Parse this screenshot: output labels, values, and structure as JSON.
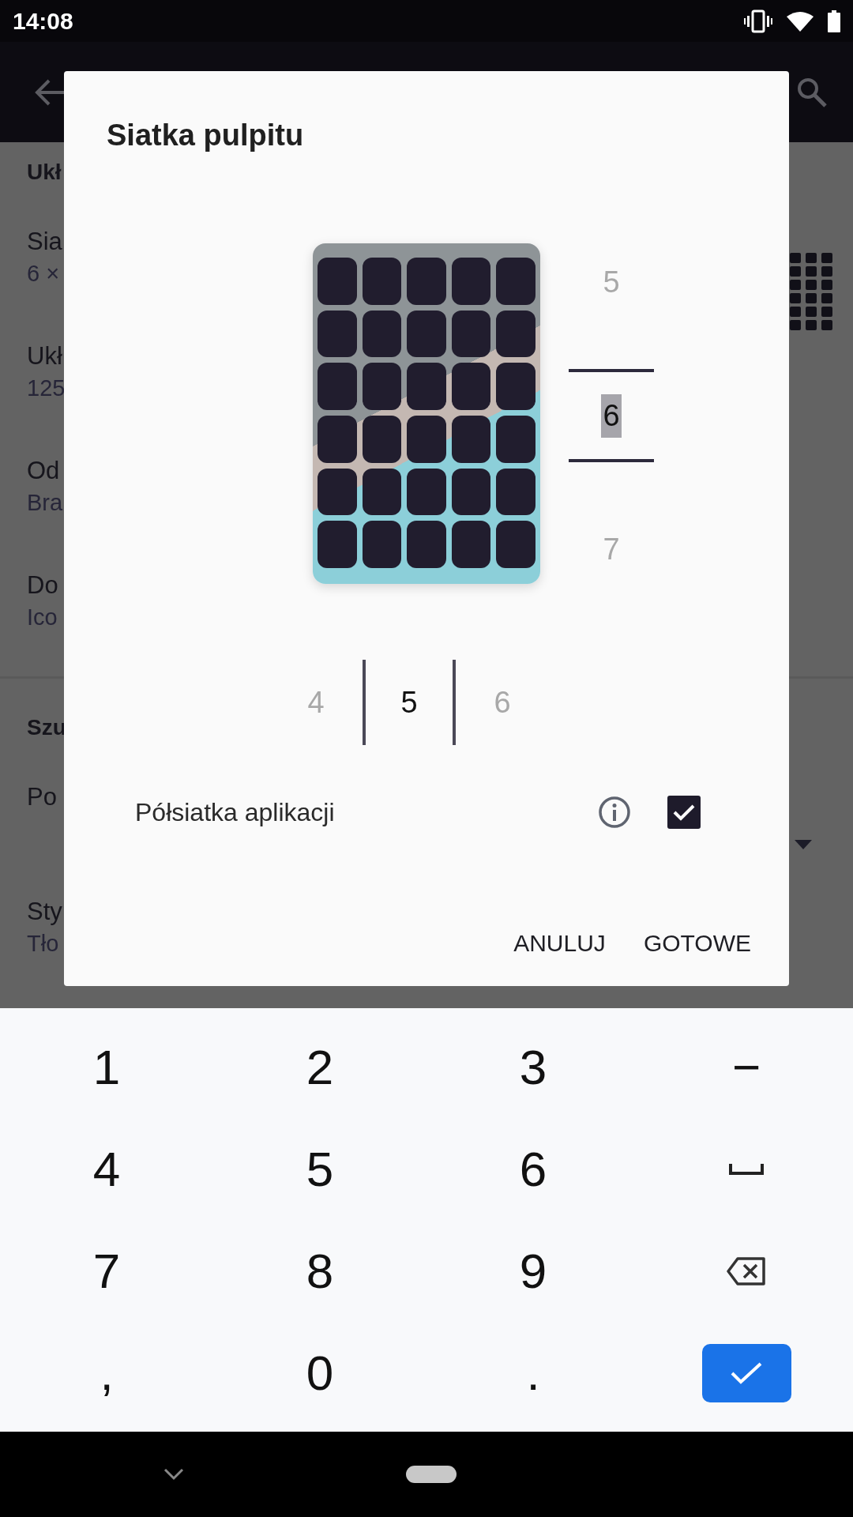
{
  "status_bar": {
    "time": "14:08"
  },
  "background": {
    "sections": [
      {
        "heading": "Ukł",
        "items": [
          {
            "title": "Sia",
            "subtitle": "6 ×"
          },
          {
            "title": "Ukł",
            "subtitle": "125"
          },
          {
            "title": "Od",
            "subtitle": "Bra"
          },
          {
            "title": "Do",
            "subtitle": "Ico"
          }
        ]
      },
      {
        "heading": "Szu",
        "items": [
          {
            "title": "Po"
          },
          {
            "title": "Sty",
            "subtitle": "Tło"
          }
        ]
      }
    ]
  },
  "dialog": {
    "title": "Siatka pulpitu",
    "rows_picker": [
      {
        "label": "5",
        "selected": false
      },
      {
        "label": "6",
        "selected": true
      },
      {
        "label": "7",
        "selected": false
      }
    ],
    "columns_picker": [
      {
        "label": "4",
        "selected": false
      },
      {
        "label": "5",
        "selected": true
      },
      {
        "label": "6",
        "selected": false
      }
    ],
    "option": {
      "label": "Półsiatka aplikacji",
      "checked": true
    },
    "buttons": [
      "ANULUJ",
      "GOTOWE"
    ]
  },
  "keyboard": {
    "keys": [
      {
        "kind": "char",
        "label": "1"
      },
      {
        "kind": "char",
        "label": "2"
      },
      {
        "kind": "char",
        "label": "3"
      },
      {
        "kind": "char",
        "label": "−"
      },
      {
        "kind": "char",
        "label": "4"
      },
      {
        "kind": "char",
        "label": "5"
      },
      {
        "kind": "char",
        "label": "6"
      },
      {
        "kind": "space"
      },
      {
        "kind": "char",
        "label": "7"
      },
      {
        "kind": "char",
        "label": "8"
      },
      {
        "kind": "char",
        "label": "9"
      },
      {
        "kind": "backspace"
      },
      {
        "kind": "char",
        "label": ","
      },
      {
        "kind": "char",
        "label": "0"
      },
      {
        "kind": "char",
        "label": "."
      },
      {
        "kind": "done"
      }
    ]
  }
}
